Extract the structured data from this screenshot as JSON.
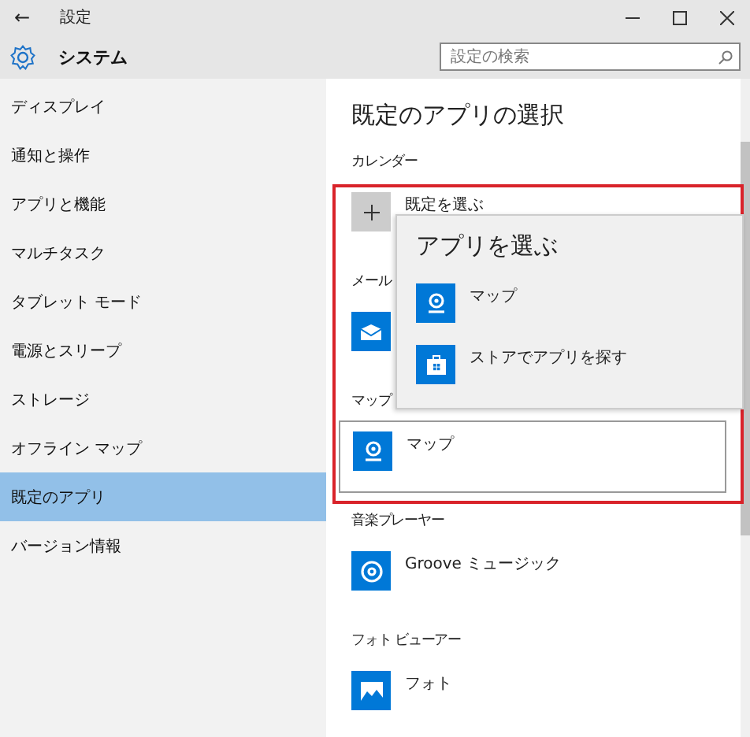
{
  "window": {
    "title": "設定",
    "back": "←"
  },
  "header": {
    "title": "システム",
    "search": {
      "placeholder": "設定の検索"
    }
  },
  "sidebar": {
    "items": [
      {
        "label": "ディスプレイ",
        "selected": false
      },
      {
        "label": "通知と操作",
        "selected": false
      },
      {
        "label": "アプリと機能",
        "selected": false
      },
      {
        "label": "マルチタスク",
        "selected": false
      },
      {
        "label": "タブレット モード",
        "selected": false
      },
      {
        "label": "電源とスリープ",
        "selected": false
      },
      {
        "label": "ストレージ",
        "selected": false
      },
      {
        "label": "オフライン マップ",
        "selected": false
      },
      {
        "label": "既定のアプリ",
        "selected": true
      },
      {
        "label": "バージョン情報",
        "selected": false
      }
    ]
  },
  "content": {
    "title": "既定のアプリの選択",
    "sections": [
      {
        "label": "カレンダー",
        "app": "既定を選ぶ",
        "kind": "add"
      },
      {
        "label": "メール",
        "kind": "mail"
      },
      {
        "label": "マップ",
        "app": "マップ",
        "kind": "map",
        "focused": true
      },
      {
        "label": "音楽プレーヤー",
        "app": "Groove ミュージック",
        "kind": "music"
      },
      {
        "label": "フォト ビューアー",
        "app": "フォト",
        "kind": "photo"
      }
    ]
  },
  "flyout": {
    "title": "アプリを選ぶ",
    "items": [
      {
        "label": "マップ",
        "kind": "map"
      },
      {
        "label": "ストアでアプリを探す",
        "kind": "store"
      }
    ]
  }
}
